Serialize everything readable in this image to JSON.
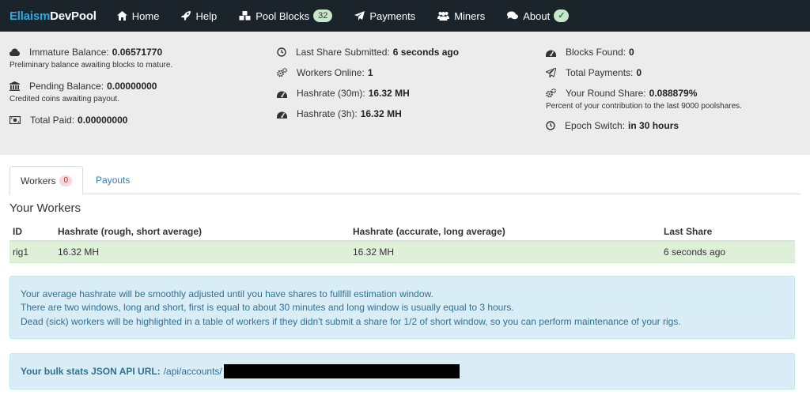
{
  "navbar": {
    "brand_part1": "Ellaism",
    "brand_part2": "DevPool",
    "items": [
      {
        "label": "Home",
        "icon": "home-icon"
      },
      {
        "label": "Help",
        "icon": "rocket-icon"
      },
      {
        "label": "Pool Blocks",
        "icon": "cubes-icon",
        "badge": "32"
      },
      {
        "label": "Payments",
        "icon": "paper-plane-icon"
      },
      {
        "label": "Miners",
        "icon": "users-icon"
      },
      {
        "label": "About",
        "icon": "comments-icon",
        "badge": "✓"
      }
    ]
  },
  "stats": {
    "immature": {
      "label": "Immature Balance:",
      "value": "0.06571770",
      "desc": "Preliminary balance awaiting blocks to mature."
    },
    "pending": {
      "label": "Pending Balance:",
      "value": "0.00000000",
      "desc": "Credited coins awaiting payout."
    },
    "paid": {
      "label": "Total Paid:",
      "value": "0.00000000"
    },
    "last_share": {
      "label": "Last Share Submitted:",
      "value": "6 seconds ago"
    },
    "workers_online": {
      "label": "Workers Online:",
      "value": "1"
    },
    "hashrate_30m": {
      "label": "Hashrate (30m):",
      "value": "16.32 MH"
    },
    "hashrate_3h": {
      "label": "Hashrate (3h):",
      "value": "16.32 MH"
    },
    "blocks_found": {
      "label": "Blocks Found:",
      "value": "0"
    },
    "total_payments": {
      "label": "Total Payments:",
      "value": "0"
    },
    "round_share": {
      "label": "Your Round Share:",
      "value": "0.088879%",
      "desc": "Percent of your contribution to the last 9000 poolshares."
    },
    "epoch": {
      "label": "Epoch Switch:",
      "value": "in 30 hours"
    }
  },
  "tabs": {
    "workers": {
      "label": "Workers",
      "count": "0"
    },
    "payouts": {
      "label": "Payouts"
    }
  },
  "section_title": "Your Workers",
  "table": {
    "headers": [
      "ID",
      "Hashrate (rough, short average)",
      "Hashrate (accurate, long average)",
      "Last Share"
    ],
    "rows": [
      [
        "rig1",
        "16.32 MH",
        "16.32 MH",
        "6 seconds ago"
      ]
    ]
  },
  "info": {
    "line1": "Your average hashrate will be smoothly adjusted until you have shares to fullfill estimation window.",
    "line2": "There are two windows, long and short, first is equal to about 30 minutes and long window is usually equal to 3 hours.",
    "line3": "Dead (sick) workers will be highlighted in a table of workers if they didn't submit a share for 1/2 of short window, so you can perform maintenance of your rigs."
  },
  "api": {
    "label": "Your bulk stats JSON API URL:",
    "path": "/api/accounts/"
  }
}
